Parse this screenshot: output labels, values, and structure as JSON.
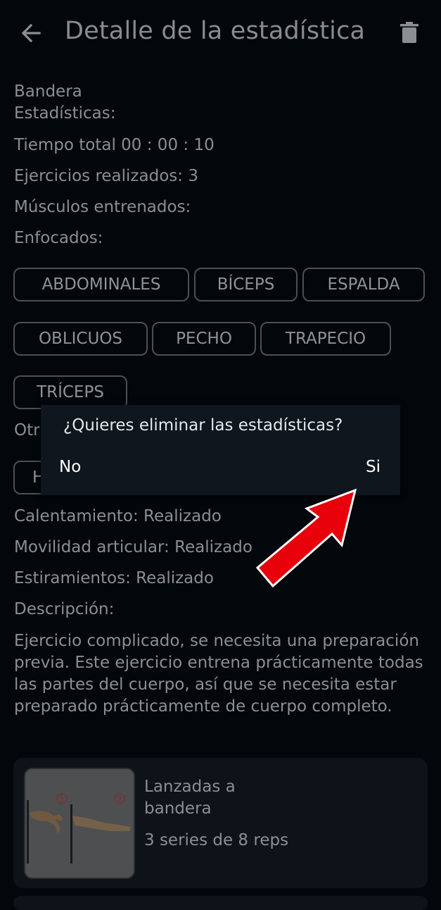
{
  "appbar": {
    "title": "Detalle de la estadística",
    "back_icon": "arrow-left-icon",
    "delete_icon": "trash-icon"
  },
  "details": {
    "name": "Bandera",
    "stats_label": "Estadísticas:",
    "total_time": "Tiempo total 00 : 00 : 10",
    "exercises_done": "Ejercicios realizados: 3",
    "muscles_label": "Músculos entrenados:",
    "focused_label": "Enfocados:",
    "focused_muscles": [
      "ABDOMINALES",
      "BÍCEPS",
      "ESPALDA",
      "OBLICUOS",
      "PECHO",
      "TRAPECIO",
      "TRÍCEPS"
    ],
    "others_label_partial": "Otr",
    "other_chip_partial": "H",
    "warmup": "Calentamiento:  Realizado",
    "mobility": "Movilidad articular:  Realizado",
    "stretching": "Estiramientos:  Realizado",
    "description_label": "Descripción:",
    "description": "Ejercicio complicado, se necesita una preparación previa. Este ejercicio entrena prácticamente todas las partes del cuerpo, así que se necesita estar preparado prácticamente de cuerpo completo."
  },
  "exercise_card": {
    "title": "Lanzadas a bandera",
    "subtitle": "3 series de 8 reps",
    "step_labels": [
      "1",
      "2"
    ]
  },
  "dialog": {
    "message": "¿Quieres eliminar las estadísticas?",
    "no_label": "No",
    "yes_label": "Si"
  },
  "colors": {
    "background": "#02070b",
    "dialog_bg": "#0f161d",
    "arrow": "#e8000b"
  }
}
